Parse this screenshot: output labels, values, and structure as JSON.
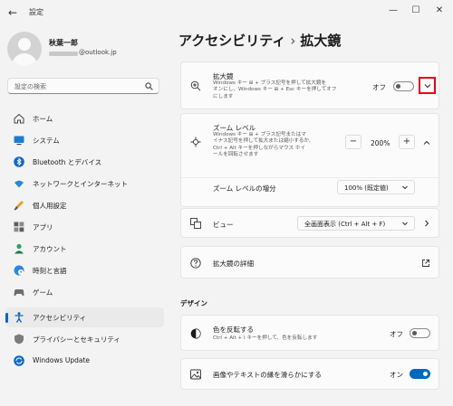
{
  "window": {
    "title": "設定"
  },
  "user": {
    "name": "秋葉一郎",
    "email_domain": "@outlook.jp"
  },
  "search": {
    "placeholder": "設定の検索"
  },
  "sidebar": {
    "items": [
      {
        "label": "ホーム",
        "icon": "home-icon"
      },
      {
        "label": "システム",
        "icon": "monitor-icon"
      },
      {
        "label": "Bluetooth とデバイス",
        "icon": "bluetooth-icon"
      },
      {
        "label": "ネットワークとインターネット",
        "icon": "wifi-icon"
      },
      {
        "label": "個人用設定",
        "icon": "brush-icon"
      },
      {
        "label": "アプリ",
        "icon": "apps-icon"
      },
      {
        "label": "アカウント",
        "icon": "account-icon"
      },
      {
        "label": "時刻と言語",
        "icon": "globe-clock-icon"
      },
      {
        "label": "ゲーム",
        "icon": "gamepad-icon"
      },
      {
        "label": "アクセシビリティ",
        "icon": "accessibility-icon",
        "active": true
      },
      {
        "label": "プライバシーとセキュリティ",
        "icon": "shield-icon"
      },
      {
        "label": "Windows Update",
        "icon": "update-icon"
      }
    ]
  },
  "header": {
    "parent": "アクセシビリティ",
    "separator": "›",
    "current": "拡大鏡"
  },
  "magnifier": {
    "title": "拡大鏡",
    "desc_line1": "Windows キー ⊞ + プラス記号を押して拡大鏡を",
    "desc_line2": "オンにし、Windows キー ⊞ + Esc キーを押してオフ",
    "desc_line3": "にします",
    "state": "オフ",
    "toggle_on": false
  },
  "zoom": {
    "title": "ズーム レベル",
    "desc_line1": "Windows キー ⊞ + プラス記号またはマ",
    "desc_line2": "イナス記号を押して拡大または縮小するか、",
    "desc_line3": "Ctrl + Alt キーを押しながらマウス ホイ",
    "desc_line4": "ールを回転させます",
    "minus": "−",
    "value": "200%",
    "plus": "+",
    "increment_label": "ズーム レベルの増分",
    "increment_value": "100% (既定値)"
  },
  "view": {
    "title": "ビュー",
    "value": "全画面表示 (Ctrl + Alt + F)"
  },
  "details": {
    "title": "拡大鏡の詳細"
  },
  "design": {
    "heading": "デザイン",
    "invert_title": "色を反転する",
    "invert_desc": "Ctrl + Alt + I キーを押して、色を反転します",
    "invert_state": "オフ",
    "invert_on": false,
    "smooth_title": "画像やテキストの縁を滑らかにする",
    "smooth_state": "オン",
    "smooth_on": true
  },
  "colors": {
    "accent": "#0067c0",
    "highlight": "#e8001c"
  }
}
